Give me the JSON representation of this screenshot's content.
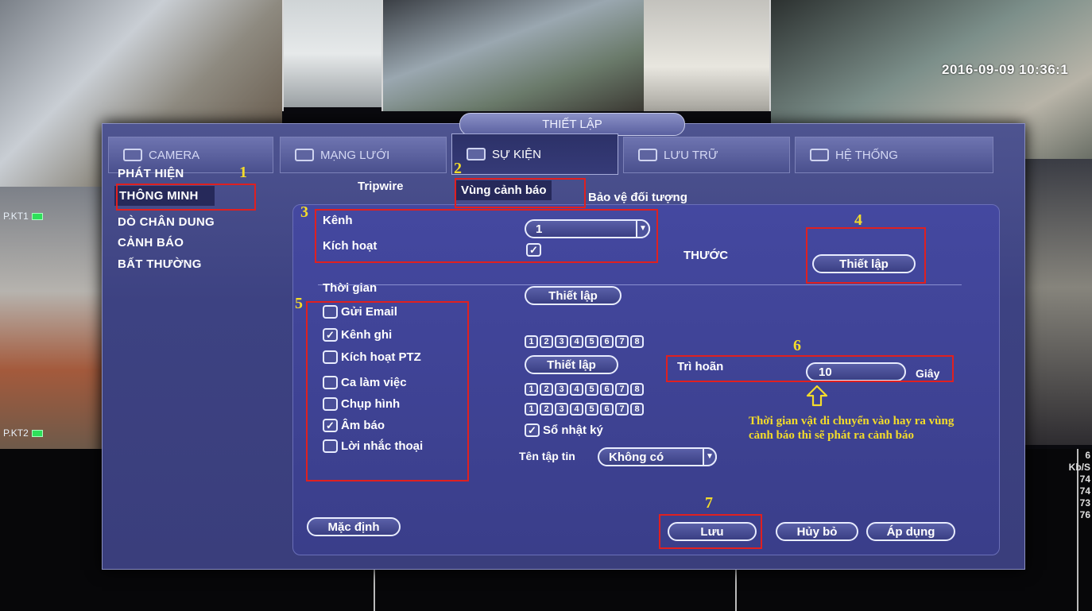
{
  "overlay": {
    "datetime": "2016-09-09 10:36:1",
    "cam_labels": [
      "P.KT1",
      "P.KT2"
    ],
    "bandwidth": [
      "6",
      "Kb/S",
      "74",
      "74",
      "73",
      "76"
    ]
  },
  "dialog": {
    "title": "THIẾT LẬP",
    "tabs": [
      "CAMERA",
      "MẠNG LƯỚI",
      "SỰ KIỆN",
      "LƯU TRỮ",
      "HỆ THỐNG"
    ],
    "active_tab": "SỰ KIỆN",
    "sidemenu": [
      "PHÁT HIỆN",
      "THÔNG MINH",
      "DÒ CHÂN DUNG",
      "CẢNH BÁO",
      "BẤT THƯỜNG"
    ],
    "subtabs": [
      "Tripwire",
      "Vùng cảnh báo",
      "Bảo vệ đối tượng"
    ]
  },
  "form": {
    "channel_label": "Kênh",
    "channel_value": "1",
    "activate_label": "Kích hoạt",
    "activate_checked": true,
    "ruler_label": "THƯỚC",
    "ruler_button": "Thiết lập",
    "time_label": "Thời gian",
    "time_button": "Thiết lập",
    "options": [
      {
        "label": "Gửi Email",
        "checked": false
      },
      {
        "label": "Kênh ghi",
        "checked": true
      },
      {
        "label": "Kích hoạt PTZ",
        "checked": false
      },
      {
        "label": "Ca làm việc",
        "checked": false
      },
      {
        "label": "Chụp hình",
        "checked": false
      },
      {
        "label": "Âm báo",
        "checked": true
      },
      {
        "label": "Lời nhắc thoại",
        "checked": false
      }
    ],
    "channel_numbers": [
      "1",
      "2",
      "3",
      "4",
      "5",
      "6",
      "7",
      "8"
    ],
    "ptz_button": "Thiết lập",
    "delay_label": "Trì hoãn",
    "delay_value": "10",
    "delay_unit": "Giây",
    "log_label": "Sổ nhật ký",
    "log_checked": true,
    "file_label": "Tên tập tin",
    "file_value": "Không có",
    "default_button": "Mặc định",
    "save_button": "Lưu",
    "cancel_button": "Hủy bỏ",
    "apply_button": "Áp dụng"
  },
  "annotations": {
    "markers": [
      "1",
      "2",
      "3",
      "4",
      "5",
      "6",
      "7"
    ],
    "note": "Thời gian vật di chuyển vào hay ra vùng cảnh báo thì sẽ phát ra cảnh báo",
    "color": "#f4dc2a"
  }
}
